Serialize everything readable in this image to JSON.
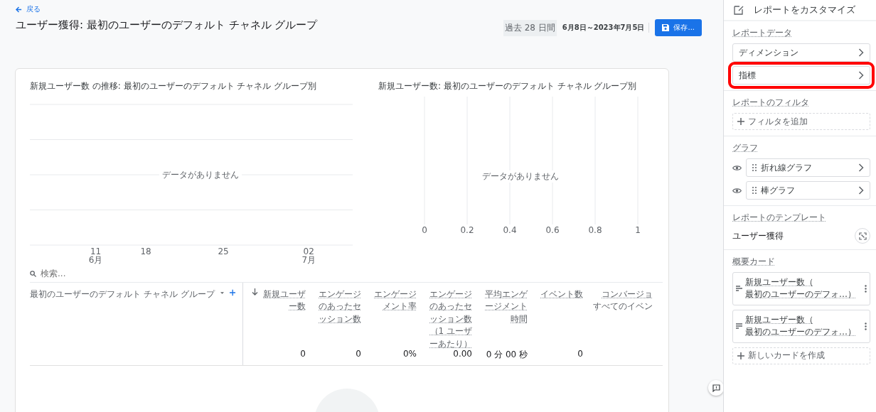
{
  "header": {
    "back_link": "戻る",
    "title": "ユーザー獲得: 最初のユーザーのデフォルト チャネル グループ",
    "date_chip": "過去 28 日間",
    "date_range": "6月8日～2023年7月5日",
    "save_button": "保存..."
  },
  "line_chart": {
    "title": "新規ユーザー数 の推移: 最初のユーザーのデフォルト チャネル グループ別",
    "empty_message": "データがありません",
    "x_labels": [
      {
        "day": "11",
        "month": "6月"
      },
      {
        "day": "18"
      },
      {
        "day": "25"
      },
      {
        "day": "02",
        "month": "7月"
      }
    ]
  },
  "bar_chart": {
    "title": "新規ユーザー数: 最初のユーザーのデフォルト チャネル グループ別",
    "empty_message": "データがありません",
    "x_labels": [
      "0",
      "0.2",
      "0.4",
      "0.6",
      "0.8",
      "1"
    ]
  },
  "table": {
    "search_placeholder": "検索...",
    "dimension_header": "最初のユーザーのデフォルト チャネル グループ",
    "columns": [
      {
        "label": "新規ユーザー数",
        "sorted": true,
        "total": "0"
      },
      {
        "label": "エンゲージのあったセッション数",
        "sorted": false,
        "total": "0"
      },
      {
        "label": "エンゲージメント率",
        "sorted": false,
        "total": "0%"
      },
      {
        "label": "エンゲージのあったセッション数（1 ユーザーあたり）",
        "sorted": false,
        "total": "0.00"
      },
      {
        "label": "平均エンゲージメント時間",
        "sorted": false,
        "total": "0 分 00 秒"
      },
      {
        "label": "イベント数",
        "sorted": false,
        "total": "0"
      },
      {
        "label": "コンバージョ",
        "sublabel": "すべてのイベン",
        "sorted": false
      }
    ]
  },
  "panel": {
    "title": "レポートをカスタマイズ",
    "report_data": {
      "heading": "レポートデータ",
      "items": [
        {
          "label": "ディメンション",
          "highlighted": false
        },
        {
          "label": "指標",
          "highlighted": true
        }
      ]
    },
    "report_filter": {
      "heading": "レポートのフィルタ",
      "add_button": "フィルタを追加"
    },
    "graphs": {
      "heading": "グラフ",
      "items": [
        {
          "label": "折れ線グラフ",
          "visible": true
        },
        {
          "label": "棒グラフ",
          "visible": true
        }
      ]
    },
    "template": {
      "heading": "レポートのテンプレート",
      "name": "ユーザー獲得"
    },
    "summary_cards": {
      "heading": "概要カード",
      "items": [
        {
          "line1": "新規ユーザー数（",
          "line2": "最初のユーザーのデフォ…）",
          "kind": "bars"
        },
        {
          "line1": "新規ユーザー数（",
          "line2": "最初のユーザーのデフォ…）",
          "kind": "table"
        }
      ],
      "add_button": "新しいカードを作成"
    }
  }
}
